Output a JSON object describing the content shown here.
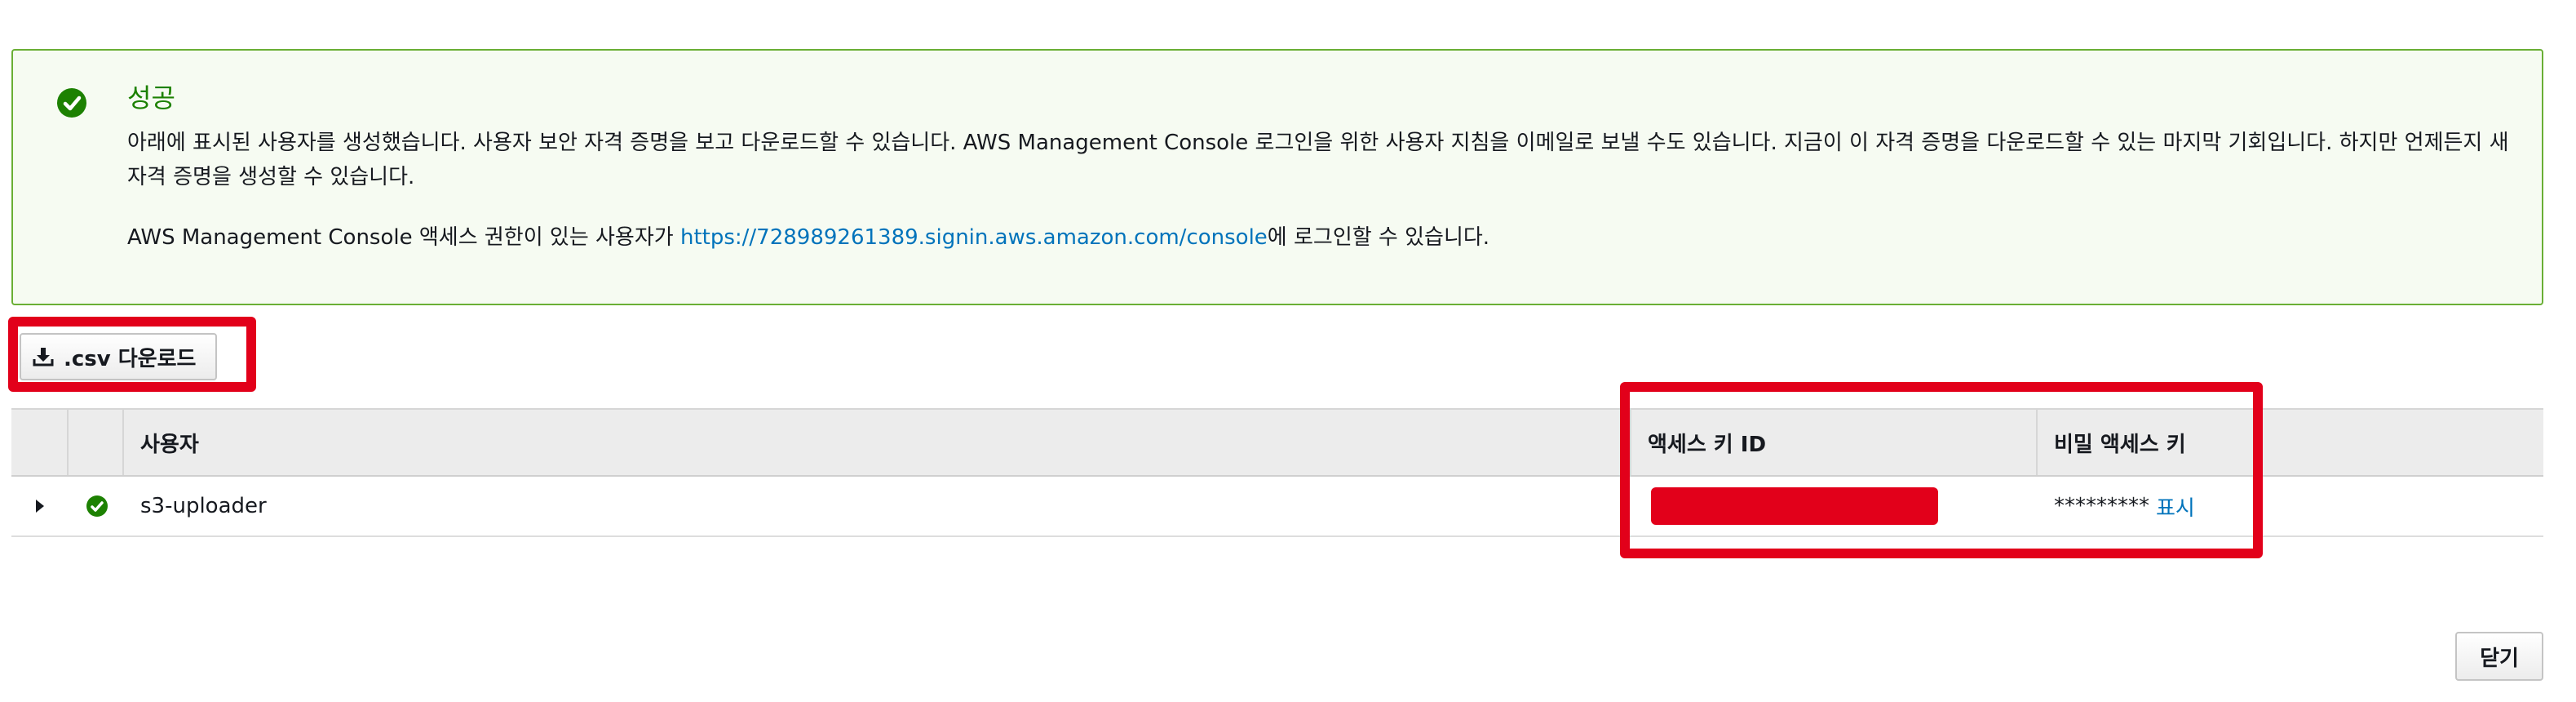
{
  "alert": {
    "title": "성공",
    "message": "아래에 표시된 사용자를 생성했습니다. 사용자 보안 자격 증명을 보고 다운로드할 수 있습니다. AWS Management Console 로그인을 위한 사용자 지침을 이메일로 보낼 수도 있습니다. 지금이 이 자격 증명을 다운로드할 수 있는 마지막 기회입니다. 하지만 언제든지 새 자격 증명을 생성할 수 있습니다.",
    "console_text_before": "AWS Management Console 액세스 권한이 있는 사용자가 ",
    "console_link": "https://728989261389.signin.aws.amazon.com/console",
    "console_text_after": "에 로그인할 수 있습니다.",
    "icon": "check-circle-icon",
    "color": "#1d8102"
  },
  "toolbar": {
    "csv_download_label": ".csv 다운로드",
    "csv_icon": "download-icon"
  },
  "table": {
    "columns": {
      "user": "사용자",
      "access_key_id": "액세스 키 ID",
      "secret_access_key": "비밀 액세스 키"
    },
    "rows": [
      {
        "user": "s3-uploader",
        "status_icon": "check-circle-icon",
        "secret_masked": "*********",
        "show_label": "표시"
      }
    ]
  },
  "footer": {
    "close_label": "닫기"
  },
  "colors": {
    "highlight": "#e2001a",
    "link": "#0073bb",
    "success": "#1d8102"
  }
}
